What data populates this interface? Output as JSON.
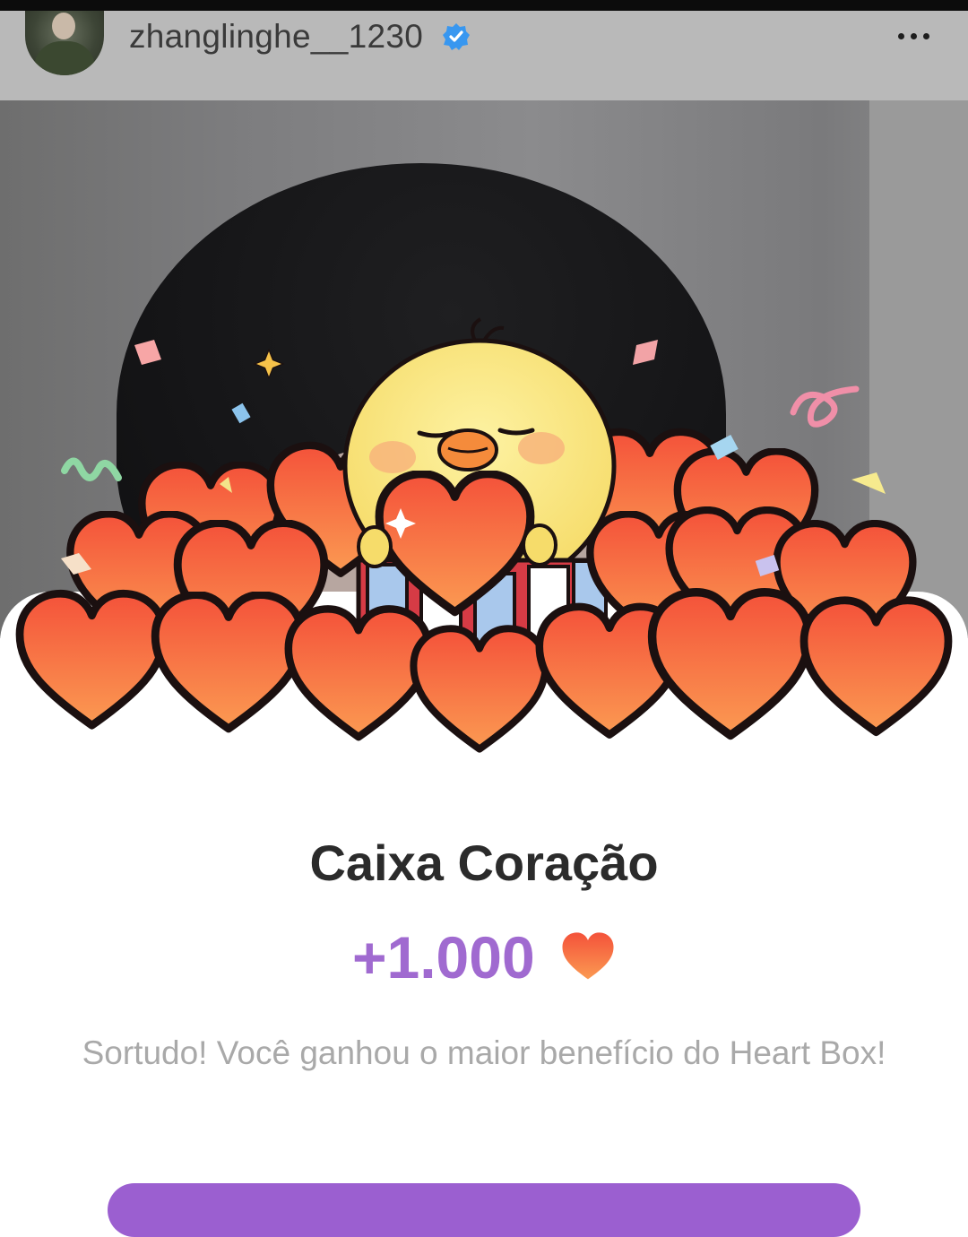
{
  "header": {
    "username": "zhanglinghe__1230",
    "verified_color": "#3897f0",
    "more_icon": "more-horizontal-icon"
  },
  "reward": {
    "title": "Caixa Coração",
    "amount": "+1.000",
    "heart_icon": "heart-icon",
    "message": "Sortudo! Você ganhou o maior benefício do Heart Box!"
  },
  "colors": {
    "accent": "#a06ad0",
    "heart": "#f0643c",
    "title": "#2b2b2b",
    "message": "#a9a9a9"
  }
}
